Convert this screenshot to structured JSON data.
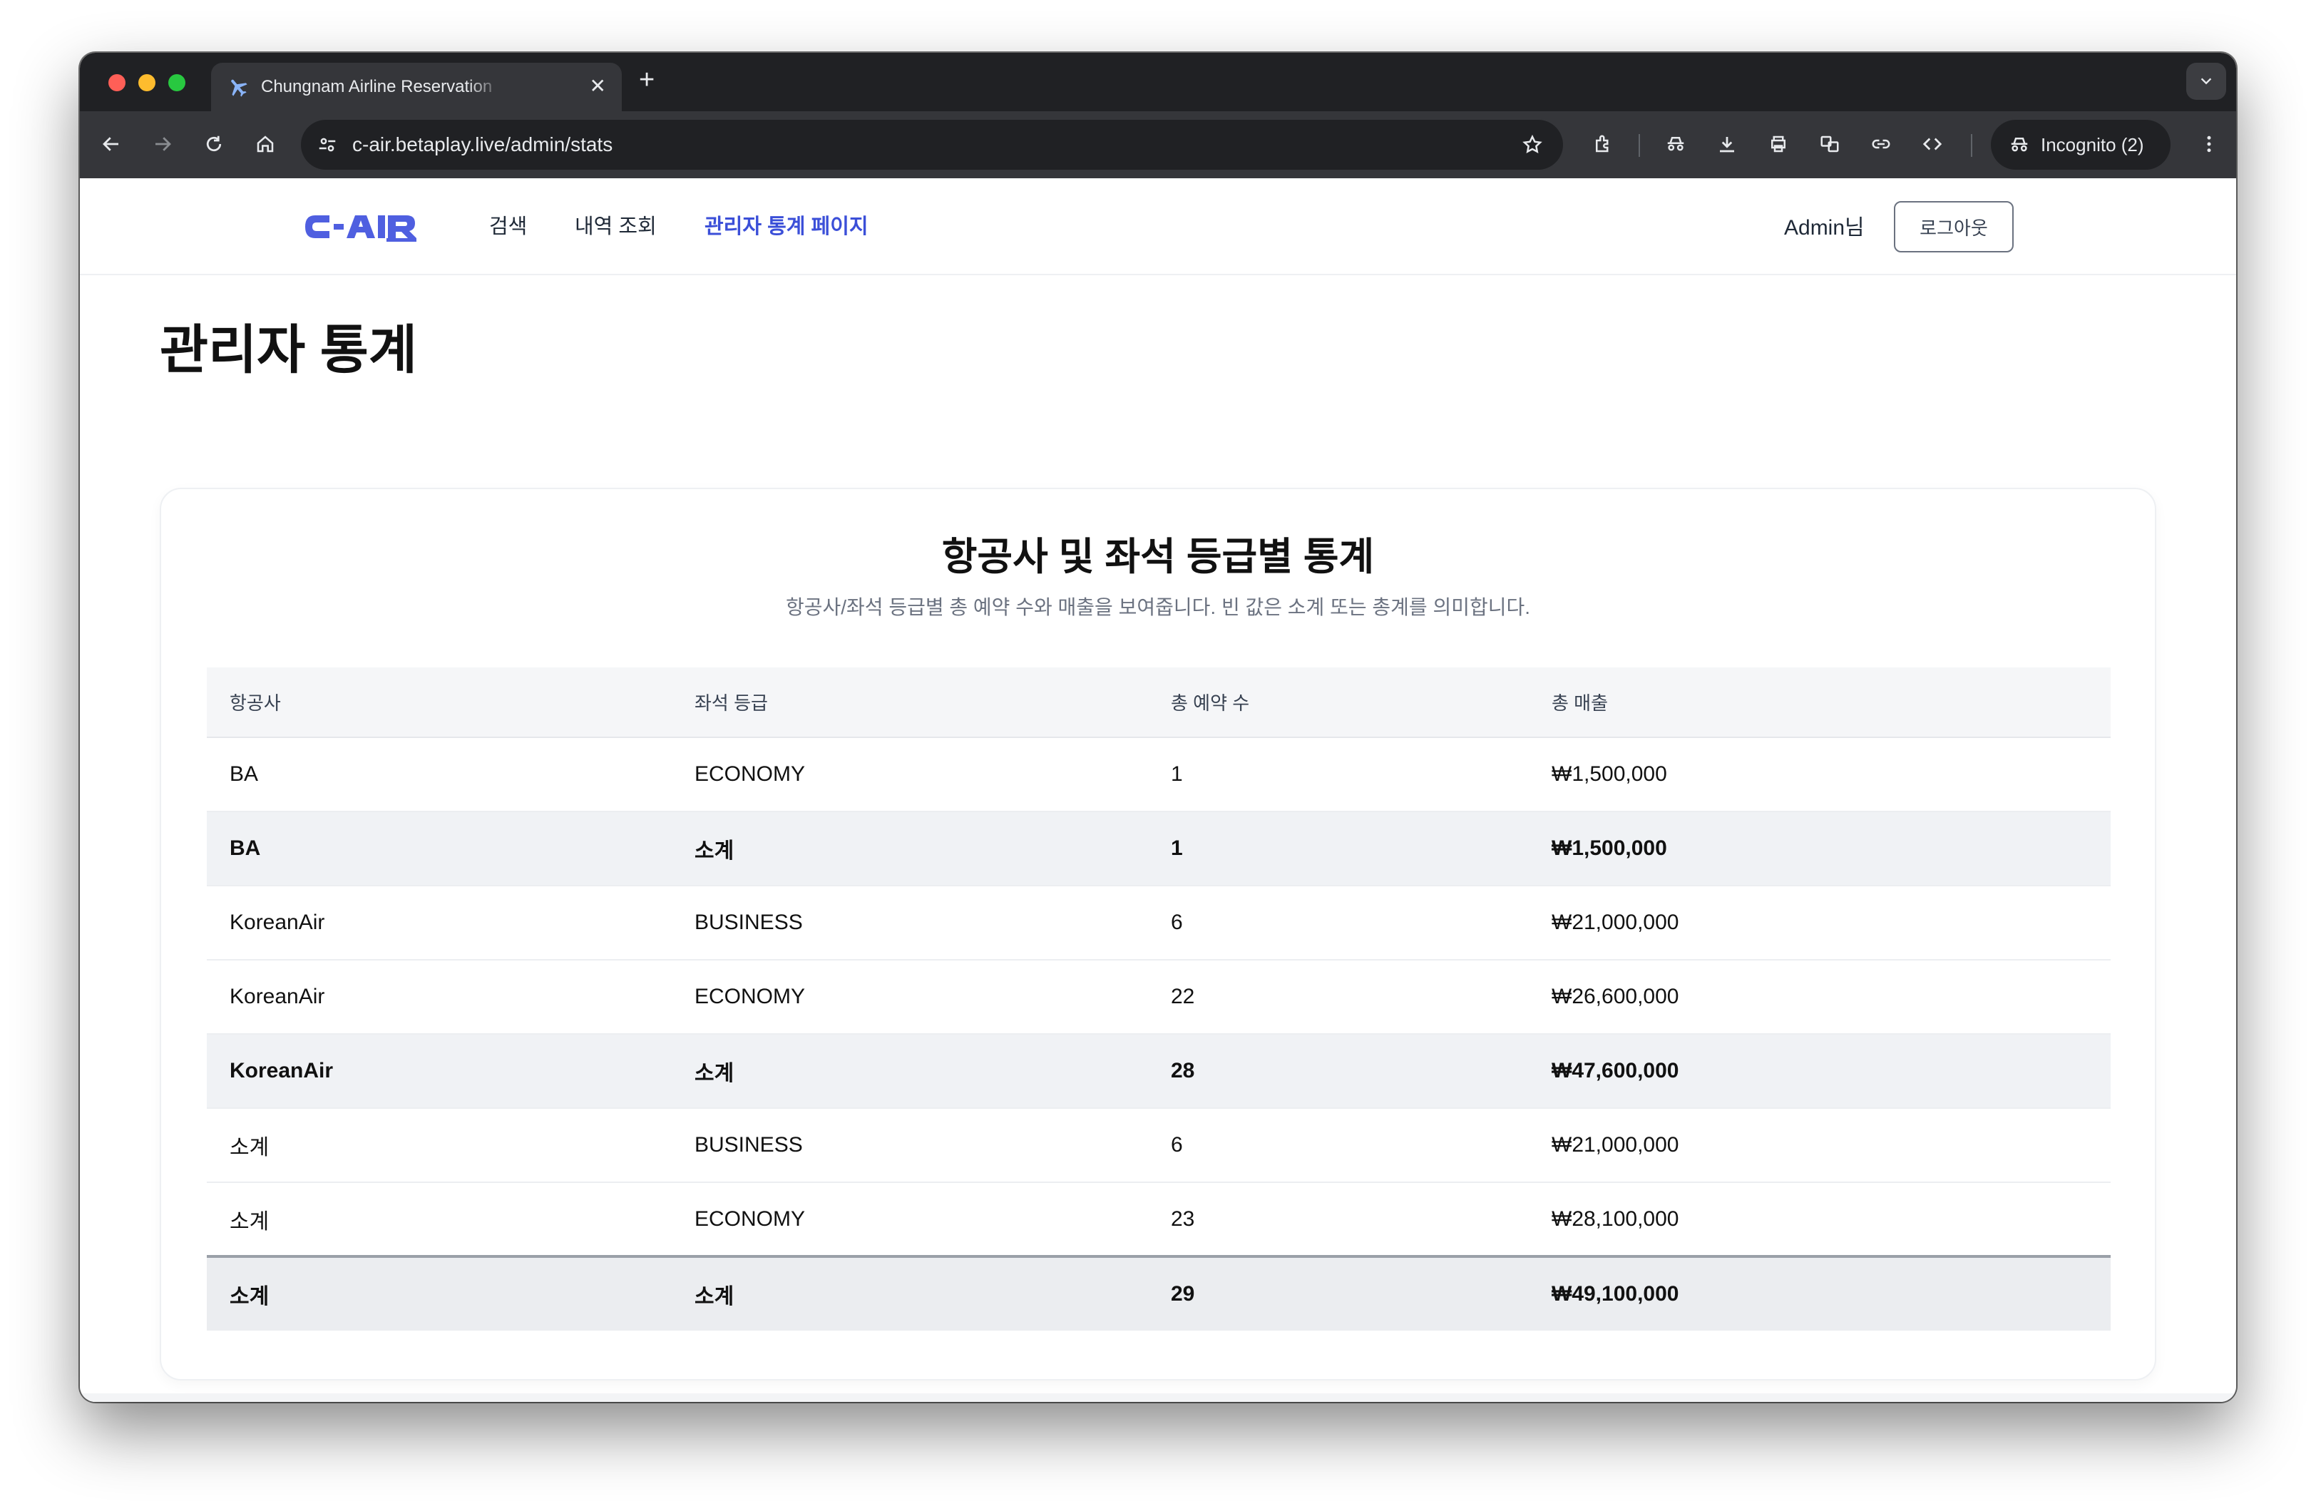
{
  "browser": {
    "tab_title": "Chungnam Airline Reservation",
    "tab_icon": "airplane-icon",
    "url": "c-air.betaplay.live/admin/stats",
    "incognito_label": "Incognito (2)"
  },
  "header": {
    "logo_text": "C-AIR",
    "nav": [
      {
        "label": "검색"
      },
      {
        "label": "내역 조회"
      },
      {
        "label": "관리자 통계 페이지",
        "active": true
      }
    ],
    "user_label": "Admin님",
    "logout_label": "로그아웃"
  },
  "page": {
    "title": "관리자 통계"
  },
  "card": {
    "title": "항공사 및 좌석 등급별 통계",
    "subtitle": "항공사/좌석 등급별 총 예약 수와 매출을 보여줍니다. 빈 값은 소계 또는 총계를 의미합니다.",
    "columns": [
      "항공사",
      "좌석 등급",
      "총 예약 수",
      "총 매출"
    ],
    "rows": [
      {
        "airline": "BA",
        "class": "ECONOMY",
        "count": "1",
        "revenue": "₩1,500,000",
        "type": "normal"
      },
      {
        "airline": "BA",
        "class": "소계",
        "count": "1",
        "revenue": "₩1,500,000",
        "type": "subtotal"
      },
      {
        "airline": "KoreanAir",
        "class": "BUSINESS",
        "count": "6",
        "revenue": "₩21,000,000",
        "type": "normal"
      },
      {
        "airline": "KoreanAir",
        "class": "ECONOMY",
        "count": "22",
        "revenue": "₩26,600,000",
        "type": "normal"
      },
      {
        "airline": "KoreanAir",
        "class": "소계",
        "count": "28",
        "revenue": "₩47,600,000",
        "type": "subtotal"
      },
      {
        "airline": "소계",
        "class": "BUSINESS",
        "count": "6",
        "revenue": "₩21,000,000",
        "type": "normal"
      },
      {
        "airline": "소계",
        "class": "ECONOMY",
        "count": "23",
        "revenue": "₩28,100,000",
        "type": "normal"
      },
      {
        "airline": "소계",
        "class": "소계",
        "count": "29",
        "revenue": "₩49,100,000",
        "type": "grand"
      }
    ]
  },
  "colors": {
    "accent": "#3b4fd8",
    "logo": "#4f5fe0"
  }
}
